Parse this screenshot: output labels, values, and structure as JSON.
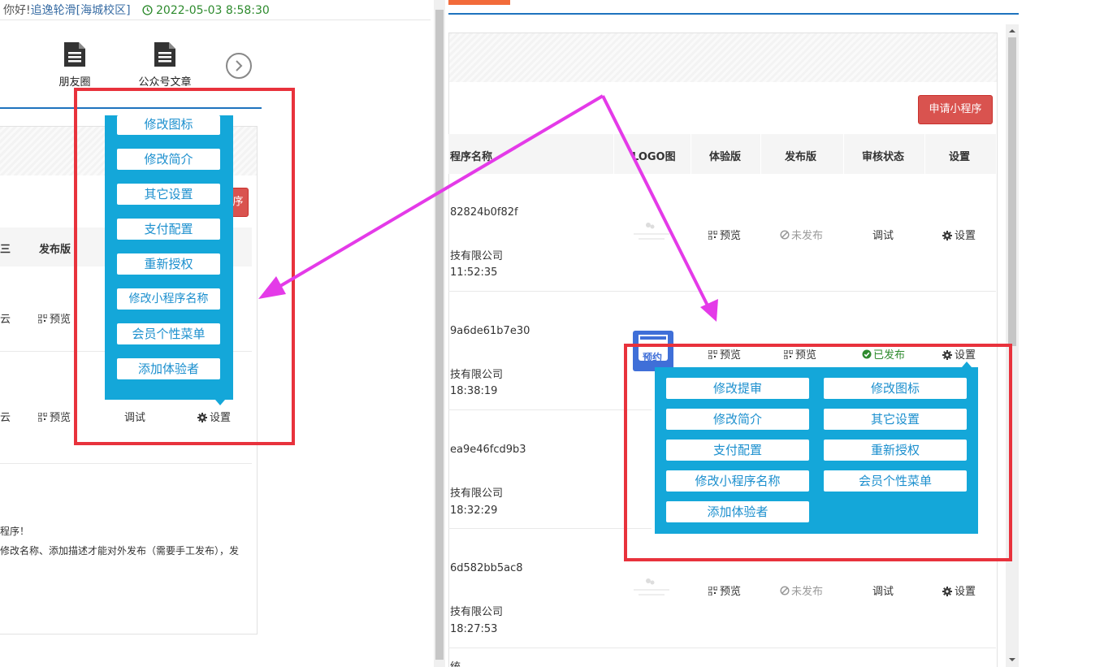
{
  "left": {
    "greeting": "你好!",
    "user": "追逸轮滑[海城校区]",
    "datetime": "2022-05-03 8:58:30",
    "nav": [
      {
        "label": "朋友圈",
        "icon": "document-icon"
      },
      {
        "label": "公众号文章",
        "icon": "document-icon"
      }
    ],
    "next_icon": "chevron-right-icon",
    "apply_button_fragment": "序",
    "headers": {
      "col1_fragment": "三",
      "publish": "发布版"
    },
    "rows": [
      {
        "col1_fragment": "云",
        "preview": "预览"
      },
      {
        "col1_fragment": "云",
        "preview": "预览",
        "review": "调试",
        "settings": "设置"
      }
    ],
    "menu": [
      "修改图标",
      "修改简介",
      "其它设置",
      "支付配置",
      "重新授权",
      "修改小程序名称",
      "会员个性菜单",
      "添加体验者"
    ],
    "notice_line1": "程序！",
    "notice_line2": "修改名称、添加描述才能对外发布（需要手工发布），发"
  },
  "right": {
    "apply_button": "申请小程序",
    "headers": {
      "name": "程序名称",
      "logo": "LOGO图",
      "trial": "体验版",
      "publish": "发布版",
      "review": "审核状态",
      "settings": "设置"
    },
    "rows": [
      {
        "appid": "82824b0f82f",
        "company": "技有限公司",
        "time": "11:52:35",
        "trial": "预览",
        "publish": "未发布",
        "review": "调试",
        "settings": "设置"
      },
      {
        "appid": "9a6de61b7e30",
        "company": "技有限公司",
        "time": "18:38:19",
        "trial": "预览",
        "publish": "预览",
        "review": "已发布",
        "settings": "设置",
        "logo_text": "预约"
      },
      {
        "appid": "ea9e46fcd9b3",
        "company": "技有限公司",
        "time": "18:32:29"
      },
      {
        "appid": "6d582bb5ac8",
        "company": "技有限公司",
        "time": "18:27:53",
        "trial": "预览",
        "publish": "未发布",
        "review": "调试",
        "settings": "设置"
      }
    ],
    "bottom_fragment": "统",
    "menu_col1": [
      "修改提审",
      "修改简介",
      "支付配置",
      "修改小程序名称",
      "添加体验者"
    ],
    "menu_col2": [
      "修改图标",
      "其它设置",
      "重新授权",
      "会员个性菜单"
    ]
  },
  "colors": {
    "menu_blue": "#14a7d9",
    "highlight_red": "#e8323c",
    "arrow_magenta": "#e43ae8",
    "link_blue": "#1e73be",
    "button_red": "#d9534f"
  }
}
